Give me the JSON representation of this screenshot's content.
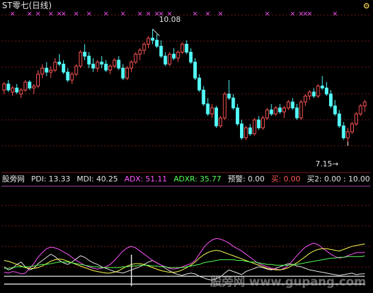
{
  "chart_title": "ST零七(日线)",
  "price_high_label": "10.08",
  "price_low_label": "7.15",
  "price_low_arrow": "→",
  "indicator": {
    "name": "股旁网",
    "pdi": "PDI: 13.33",
    "mdi": "MDI: 40.25",
    "adx": "ADX: 51.11",
    "adxr": "ADXR: 35.77",
    "warn": "预警: 0.00",
    "buy": "买: 0.00",
    "buy2": "买2: 0.00 : 10.00"
  },
  "watermark": "股旁网  www.gupang.com",
  "colors": {
    "background": "#000000",
    "grid": "#7a1a1a",
    "up_candle": "#ff5555",
    "down_candle": "#54ffff",
    "pdi": "#e6e6e6",
    "mdi": "#ff55ff",
    "adx": "#ffff55",
    "adxr": "#55ff55",
    "buy": "#ff5555",
    "signal_marker": "#ff55ff"
  },
  "icons": {
    "settings": "settings-icon"
  },
  "chart_data": [
    {
      "type": "candlestick",
      "title": "ST零七(日线)",
      "max_price": 10.08,
      "min_price": 7.15,
      "ylim": [
        6.6,
        10.5
      ],
      "grid": true,
      "candles": [
        [
          8.55,
          8.75,
          8.45,
          8.7
        ],
        [
          8.7,
          8.8,
          8.5,
          8.55
        ],
        [
          8.5,
          8.65,
          8.4,
          8.6
        ],
        [
          8.6,
          8.7,
          8.45,
          8.5
        ],
        [
          8.45,
          8.6,
          8.35,
          8.55
        ],
        [
          8.55,
          8.8,
          8.5,
          8.75
        ],
        [
          8.75,
          8.8,
          8.55,
          8.6
        ],
        [
          8.6,
          8.7,
          8.45,
          8.65
        ],
        [
          8.65,
          9.05,
          8.6,
          8.95
        ],
        [
          8.95,
          9.2,
          8.85,
          9.1
        ],
        [
          9.1,
          9.25,
          8.9,
          9.0
        ],
        [
          9.0,
          9.15,
          8.85,
          9.05
        ],
        [
          9.05,
          9.35,
          9.0,
          9.25
        ],
        [
          9.25,
          9.45,
          9.15,
          9.2
        ],
        [
          9.2,
          9.3,
          8.95,
          9.0
        ],
        [
          9.0,
          9.1,
          8.75,
          8.8
        ],
        [
          8.8,
          9.0,
          8.7,
          8.95
        ],
        [
          8.95,
          9.2,
          8.9,
          9.15
        ],
        [
          9.15,
          9.55,
          9.1,
          9.5
        ],
        [
          9.5,
          9.7,
          9.3,
          9.4
        ],
        [
          9.4,
          9.5,
          9.1,
          9.2
        ],
        [
          9.2,
          9.35,
          9.0,
          9.1
        ],
        [
          9.1,
          9.3,
          9.0,
          9.25
        ],
        [
          9.25,
          9.4,
          9.1,
          9.2
        ],
        [
          9.2,
          9.3,
          9.0,
          9.05
        ],
        [
          9.05,
          9.2,
          8.95,
          9.15
        ],
        [
          9.15,
          9.35,
          9.1,
          9.3
        ],
        [
          9.3,
          9.4,
          9.05,
          9.1
        ],
        [
          9.1,
          9.2,
          8.8,
          8.85
        ],
        [
          8.85,
          9.15,
          8.8,
          9.1
        ],
        [
          9.1,
          9.3,
          9.0,
          9.25
        ],
        [
          9.25,
          9.5,
          9.2,
          9.45
        ],
        [
          9.45,
          9.6,
          9.3,
          9.55
        ],
        [
          9.55,
          9.75,
          9.45,
          9.7
        ],
        [
          9.7,
          9.9,
          9.6,
          9.85
        ],
        [
          9.85,
          10.08,
          9.7,
          9.8
        ],
        [
          9.8,
          9.95,
          9.6,
          9.65
        ],
        [
          9.65,
          9.8,
          9.35,
          9.4
        ],
        [
          9.4,
          9.5,
          9.15,
          9.2
        ],
        [
          9.2,
          9.5,
          9.15,
          9.45
        ],
        [
          9.45,
          9.6,
          9.3,
          9.35
        ],
        [
          9.35,
          9.55,
          9.25,
          9.5
        ],
        [
          9.5,
          9.75,
          9.45,
          9.7
        ],
        [
          9.7,
          9.8,
          9.45,
          9.5
        ],
        [
          9.5,
          9.6,
          9.2,
          9.25
        ],
        [
          9.25,
          9.35,
          8.8,
          8.85
        ],
        [
          8.85,
          8.95,
          8.5,
          8.55
        ],
        [
          8.55,
          8.65,
          8.15,
          8.2
        ],
        [
          8.2,
          8.35,
          7.9,
          7.95
        ],
        [
          7.95,
          8.2,
          7.85,
          8.1
        ],
        [
          8.1,
          8.15,
          7.6,
          7.65
        ],
        [
          7.65,
          7.9,
          7.6,
          7.85
        ],
        [
          7.85,
          8.5,
          7.8,
          8.45
        ],
        [
          8.45,
          8.8,
          8.3,
          8.35
        ],
        [
          8.35,
          8.45,
          8.05,
          8.1
        ],
        [
          8.1,
          8.2,
          7.65,
          7.7
        ],
        [
          7.7,
          7.8,
          7.3,
          7.35
        ],
        [
          7.35,
          7.65,
          7.3,
          7.6
        ],
        [
          7.6,
          7.7,
          7.4,
          7.45
        ],
        [
          7.45,
          7.85,
          7.4,
          7.8
        ],
        [
          7.8,
          7.9,
          7.55,
          7.6
        ],
        [
          7.6,
          7.9,
          7.55,
          7.85
        ],
        [
          7.85,
          8.1,
          7.8,
          8.05
        ],
        [
          8.05,
          8.2,
          7.9,
          7.95
        ],
        [
          7.95,
          8.15,
          7.9,
          8.1
        ],
        [
          8.1,
          8.2,
          7.95,
          8.0
        ],
        [
          8.0,
          8.15,
          7.85,
          8.1
        ],
        [
          8.1,
          8.3,
          8.05,
          8.25
        ],
        [
          8.25,
          8.35,
          8.05,
          8.1
        ],
        [
          8.1,
          8.2,
          7.8,
          7.85
        ],
        [
          7.85,
          8.3,
          7.8,
          8.25
        ],
        [
          8.25,
          8.45,
          8.15,
          8.4
        ],
        [
          8.4,
          8.55,
          8.3,
          8.5
        ],
        [
          8.5,
          8.6,
          8.35,
          8.4
        ],
        [
          8.4,
          8.7,
          8.35,
          8.65
        ],
        [
          8.65,
          8.9,
          8.55,
          8.6
        ],
        [
          8.6,
          8.75,
          8.4,
          8.45
        ],
        [
          8.45,
          8.55,
          8.1,
          8.15
        ],
        [
          8.15,
          8.3,
          7.9,
          7.95
        ],
        [
          7.95,
          8.05,
          7.6,
          7.65
        ],
        [
          7.65,
          7.75,
          7.3,
          7.35
        ],
        [
          7.35,
          7.6,
          7.15,
          7.5
        ],
        [
          7.5,
          7.75,
          7.45,
          7.7
        ],
        [
          7.7,
          8.0,
          7.65,
          7.95
        ],
        [
          7.95,
          8.2,
          7.9,
          8.15
        ],
        [
          8.15,
          8.3,
          8.0,
          8.25
        ]
      ]
    },
    {
      "type": "line",
      "title": "股旁网",
      "ylim": [
        0,
        100
      ],
      "series": [
        {
          "name": "PDI",
          "values": [
            22,
            18,
            20,
            25,
            28,
            22,
            18,
            20,
            26,
            30,
            34,
            38,
            35,
            30,
            27,
            25,
            28,
            32,
            36,
            34,
            30,
            27,
            25,
            22,
            20,
            18,
            16,
            15,
            14,
            16,
            18,
            20,
            22,
            25,
            28,
            30,
            27,
            24,
            20,
            17,
            14,
            12,
            11,
            13,
            14,
            13,
            10,
            8,
            6,
            5,
            7,
            9,
            14,
            18,
            16,
            14,
            12,
            16,
            18,
            20,
            22,
            21,
            19,
            18,
            20,
            22,
            24,
            26,
            25,
            23,
            22,
            20,
            18,
            17,
            16,
            15,
            14,
            13,
            12,
            11,
            12,
            13,
            14,
            12,
            13,
            13.33
          ]
        },
        {
          "name": "MDI",
          "values": [
            15,
            14,
            16,
            15,
            13,
            14,
            20,
            26,
            34,
            40,
            45,
            47,
            46,
            44,
            41,
            38,
            34,
            30,
            27,
            24,
            22,
            20,
            19,
            20,
            22,
            25,
            30,
            36,
            42,
            46,
            48,
            46,
            42,
            38,
            34,
            30,
            27,
            24,
            22,
            20,
            19,
            20,
            22,
            24,
            26,
            30,
            38,
            46,
            52,
            56,
            58,
            57,
            55,
            52,
            48,
            45,
            42,
            38,
            34,
            30,
            26,
            24,
            22,
            20,
            19,
            18,
            20,
            24,
            30,
            36,
            42,
            47,
            50,
            52,
            50,
            46,
            42,
            38,
            35,
            33,
            34,
            36,
            38,
            40,
            40,
            40.25
          ]
        },
        {
          "name": "ADX",
          "values": [
            30,
            29,
            27,
            25,
            23,
            21,
            20,
            20,
            21,
            23,
            26,
            29,
            31,
            32,
            31,
            29,
            27,
            25,
            23,
            21,
            19,
            17,
            16,
            15,
            14,
            14,
            15,
            17,
            20,
            23,
            25,
            26,
            26,
            25,
            23,
            21,
            19,
            17,
            16,
            15,
            15,
            16,
            18,
            21,
            24,
            28,
            33,
            37,
            40,
            42,
            43,
            42,
            40,
            38,
            36,
            34,
            32,
            30,
            28,
            26,
            24,
            22,
            20,
            19,
            18,
            18,
            19,
            21,
            24,
            27,
            31,
            35,
            39,
            42,
            44,
            45,
            45,
            44,
            43,
            42,
            44,
            46,
            48,
            49,
            50,
            51.11
          ]
        },
        {
          "name": "ADXR",
          "values": [
            20,
            20,
            21,
            22,
            22,
            22,
            22,
            23,
            24,
            25,
            25,
            26,
            27,
            28,
            28,
            28,
            27,
            26,
            25,
            24,
            23,
            22,
            22,
            21,
            21,
            21,
            21,
            21,
            22,
            22,
            23,
            23,
            24,
            24,
            24,
            23,
            23,
            22,
            22,
            21,
            21,
            21,
            21,
            22,
            23,
            24,
            25,
            27,
            28,
            29,
            30,
            31,
            31,
            31,
            31,
            30,
            30,
            29,
            28,
            28,
            27,
            26,
            25,
            25,
            24,
            24,
            24,
            24,
            25,
            25,
            26,
            27,
            28,
            29,
            30,
            31,
            32,
            33,
            33,
            34,
            34,
            35,
            35,
            35,
            35,
            35.77
          ]
        },
        {
          "name": "预警",
          "values": [
            0,
            0,
            0,
            0,
            0,
            0,
            0,
            0,
            0,
            0,
            0,
            0,
            0,
            0,
            0,
            0,
            0,
            0,
            0,
            0,
            0,
            0,
            0,
            0,
            0,
            0,
            0,
            0,
            0,
            0,
            0,
            0,
            0,
            0,
            0,
            0,
            0,
            0,
            0,
            0,
            0,
            0,
            0,
            0,
            0,
            0,
            0,
            0,
            0,
            0,
            0,
            0,
            0,
            0,
            0,
            0,
            0,
            0,
            0,
            0,
            0,
            0,
            0,
            0,
            0,
            0,
            0,
            0,
            0,
            0,
            0,
            0,
            0,
            0,
            0,
            0,
            0,
            0,
            0,
            0,
            0,
            0,
            0,
            0,
            0,
            0
          ]
        },
        {
          "name": "买2",
          "values": [
            10,
            10,
            10,
            10,
            10,
            10,
            10,
            10,
            10,
            10,
            10,
            10,
            10,
            10,
            10,
            10,
            10,
            10,
            10,
            10,
            10,
            10,
            10,
            10,
            10,
            10,
            10,
            10,
            10,
            10,
            10,
            10,
            10,
            10,
            10,
            10,
            10,
            10,
            10,
            10,
            10,
            10,
            10,
            10,
            10,
            10,
            10,
            10,
            10,
            10,
            10,
            10,
            10,
            10,
            10,
            10,
            10,
            10,
            10,
            10,
            10,
            10,
            10,
            10,
            10,
            10,
            10,
            10,
            10,
            10,
            10,
            10,
            10,
            10,
            10,
            10,
            10,
            10,
            10,
            10,
            10,
            10,
            10,
            10,
            10,
            10
          ]
        }
      ],
      "signals": [
        2,
        6,
        8,
        11,
        13,
        14,
        17,
        20,
        24,
        28,
        32,
        34,
        36,
        37,
        39,
        45,
        48,
        51,
        62,
        68,
        70,
        71,
        72,
        78
      ]
    }
  ]
}
